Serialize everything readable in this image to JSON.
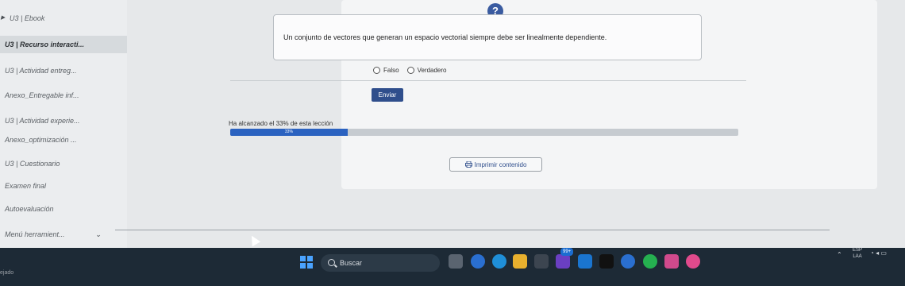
{
  "sidebar": {
    "items": [
      {
        "label": "U3 | Ebook"
      },
      {
        "label": "U3 | Recurso interacti..."
      },
      {
        "label": "U3 | Actividad entreg..."
      },
      {
        "label": "Anexo_Entregable inf..."
      },
      {
        "label": "U3 | Actividad experie..."
      },
      {
        "label": "Anexo_optimización ..."
      },
      {
        "label": "U3 | Cuestionario"
      },
      {
        "label": "Examen final"
      },
      {
        "label": "Autoevaluación"
      },
      {
        "label": "Menú herramient..."
      }
    ]
  },
  "question": {
    "help_label": "?",
    "text": "Un conjunto de vectores que generan un espacio vectorial siempre debe ser linealmente dependiente.",
    "options": [
      "Falso",
      "Verdadero"
    ],
    "submit_label": "Enviar"
  },
  "progress": {
    "label": "Ha alcanzado el 33% de esta lección",
    "percent_text": "33%",
    "percent": 33
  },
  "print_button": {
    "label": "Imprimir contenido"
  },
  "taskbar": {
    "search_placeholder": "Buscar",
    "badge": "99+",
    "lang_top": "ESP",
    "lang_bottom": "LAA",
    "edge_text": "ejado"
  },
  "colors": {
    "accent": "#2b62c0",
    "button": "#2f4e8c",
    "taskbar": "#1d2a36"
  }
}
